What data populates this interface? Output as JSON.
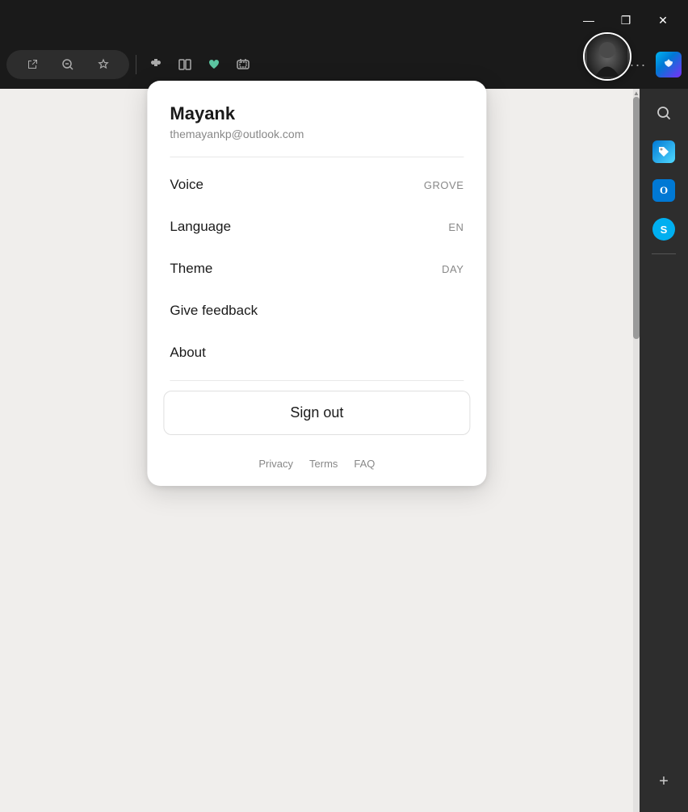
{
  "titleBar": {
    "minimizeLabel": "—",
    "restoreLabel": "❐",
    "closeLabel": "✕"
  },
  "toolbar": {
    "openTabIcon": "↗",
    "zoomOutIcon": "🔍",
    "favoriteIcon": "☆",
    "extensionsIcon": "🧩",
    "splitViewIcon": "⊟",
    "heartsIcon": "♥",
    "screenshotIcon": "⊡",
    "shareIcon": "↗",
    "moreIcon": "···"
  },
  "sidebar": {
    "searchIcon": "🔍",
    "addIcon": "+",
    "items": [
      {
        "name": "tags-icon",
        "label": "Tags"
      },
      {
        "name": "outlook-icon",
        "label": "Outlook"
      },
      {
        "name": "skype-icon",
        "label": "Skype"
      }
    ]
  },
  "user": {
    "name": "Mayank",
    "email": "themayankp@outlook.com"
  },
  "menu": {
    "voice": {
      "label": "Voice",
      "value": "GROVE"
    },
    "language": {
      "label": "Language",
      "value": "EN"
    },
    "theme": {
      "label": "Theme",
      "value": "DAY"
    },
    "giveFeedback": {
      "label": "Give feedback"
    },
    "about": {
      "label": "About"
    }
  },
  "signOut": {
    "label": "Sign out"
  },
  "footer": {
    "privacy": "Privacy",
    "terms": "Terms",
    "faq": "FAQ"
  }
}
